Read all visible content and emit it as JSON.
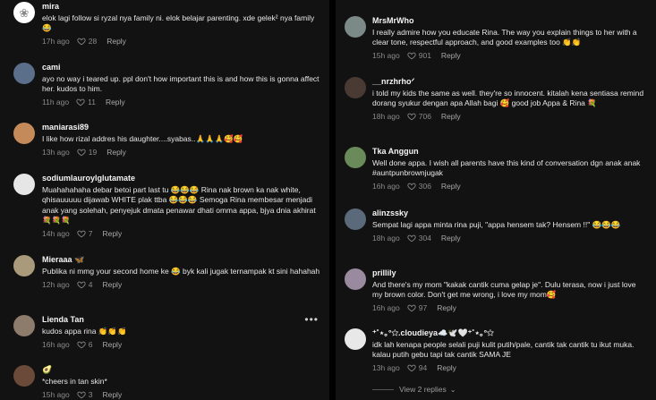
{
  "left_comments": [
    {
      "user": "mira",
      "text": "elok lagi follow si ryzal nya family ni. elok belajar parenting. xde gelek² nya family😂",
      "time": "17h ago",
      "likes": "28",
      "reply": "Reply",
      "avatar_color": "#ffffff",
      "avatar_glyph": "❀",
      "avatar_fg": "#888888"
    },
    {
      "user": "cami",
      "text": "ayo no way i teared up. ppl don't how important this is and how this is gonna affect her. kudos to him.",
      "time": "11h ago",
      "likes": "11",
      "reply": "Reply",
      "avatar_color": "#5b6f8a",
      "avatar_glyph": "",
      "avatar_fg": "#ffffff"
    },
    {
      "user": "maniarasi89",
      "text": "I like how rizal addres his daughter....syabas..🙏🙏🙏🥰🥰",
      "time": "13h ago",
      "likes": "19",
      "reply": "Reply",
      "avatar_color": "#c48a5a",
      "avatar_glyph": "",
      "avatar_fg": "#ffffff"
    },
    {
      "user": "sodiumlauroylglutamate",
      "text": "Muahahahaha debar betoi part last tu 😂😂😂 Rina nak brown ka nak white, qhisauuuuu dijawab WHITE plak ttba 😂😂😂 Semoga Rina membesar menjadi anak yang solehah, penyejuk dmata penawar dhati omma appa, bjya dnia akhirat 💐💐💐",
      "time": "14h ago",
      "likes": "7",
      "reply": "Reply",
      "avatar_color": "#e6e6e6",
      "avatar_glyph": "",
      "avatar_fg": "#ffffff"
    },
    {
      "user": "Mieraaa 🦋",
      "text": "Publika ni mmg your second home ke 😂 byk kali jugak ternampak kt sini hahahah",
      "time": "12h ago",
      "likes": "4",
      "reply": "Reply",
      "avatar_color": "#a89a7a",
      "avatar_glyph": "",
      "avatar_fg": "#ffffff"
    },
    {
      "user": "Lienda Tan",
      "text": "kudos appa rina 👏👏👏",
      "time": "16h ago",
      "likes": "6",
      "reply": "Reply",
      "avatar_color": "#8d7b6c",
      "avatar_glyph": "",
      "avatar_fg": "#ffffff",
      "has_dots": true
    },
    {
      "user": "🥑",
      "text": "*cheers in tan skin*",
      "time": "15h ago",
      "likes": "3",
      "reply": "Reply",
      "avatar_color": "#6b4a3a",
      "avatar_glyph": "",
      "avatar_fg": "#ffffff"
    }
  ],
  "right_comments": [
    {
      "user": "MrsMrWho",
      "text": "I really admire how you educate Rina. The way you explain things to her with a clear tone, respectful approach, and good examples too 👏👏",
      "time": "15h ago",
      "likes": "901",
      "reply": "Reply",
      "avatar_color": "#7b8a86",
      "avatar_glyph": "",
      "avatar_fg": "#ffffff"
    },
    {
      "user": "__nrzhrhoᐟ",
      "text": "i told my kids the same as well. they're so innocent. kitalah kena sentiasa remind dorang syukur dengan apa Allah bagi 🥰 good job Appa & Rina 💐",
      "time": "18h ago",
      "likes": "706",
      "reply": "Reply",
      "avatar_color": "#4a3a34",
      "avatar_glyph": "",
      "avatar_fg": "#ffffff"
    },
    {
      "user": "Tka Anggun",
      "text": "Well done appa. I wish all parents have this kind of conversation dgn anak anak #auntpunbrownjugak",
      "time": "16h ago",
      "likes": "306",
      "reply": "Reply",
      "avatar_color": "#6a8a5a",
      "avatar_glyph": "",
      "avatar_fg": "#ffffff"
    },
    {
      "user": "alinzssky",
      "text": "Sempat lagi appa minta rina puji, \"appa hensem tak? Hensem !!\" 😂😂😂",
      "time": "18h ago",
      "likes": "304",
      "reply": "Reply",
      "avatar_color": "#5a6a7a",
      "avatar_glyph": "",
      "avatar_fg": "#ffffff"
    },
    {
      "user": "prillily",
      "text": "And there's my mom \"kakak cantik cuma gelap je\". Dulu terasa, now i just love my brown color. Don't get me wrong, i love my mom🥰",
      "time": "16h ago",
      "likes": "97",
      "reply": "Reply",
      "avatar_color": "#9a8aa0",
      "avatar_glyph": "",
      "avatar_fg": "#ffffff"
    },
    {
      "user": "⁺˚⋆｡°✩.cloudieya☁️🕊️🤍⁺˚⋆｡°✩",
      "text": "idk lah kenapa people selali puji kulit putih/pale, cantik tak cantik tu ikut muka. kalau putih gebu tapi tak cantik SAMA JE",
      "time": "13h ago",
      "likes": "94",
      "reply": "Reply",
      "avatar_color": "#e8e8e8",
      "avatar_glyph": "",
      "avatar_fg": "#ffffff"
    }
  ],
  "view_replies": "View 2 replies",
  "more_icon": "more-options-icon",
  "heart_icon": "heart-outline-icon"
}
